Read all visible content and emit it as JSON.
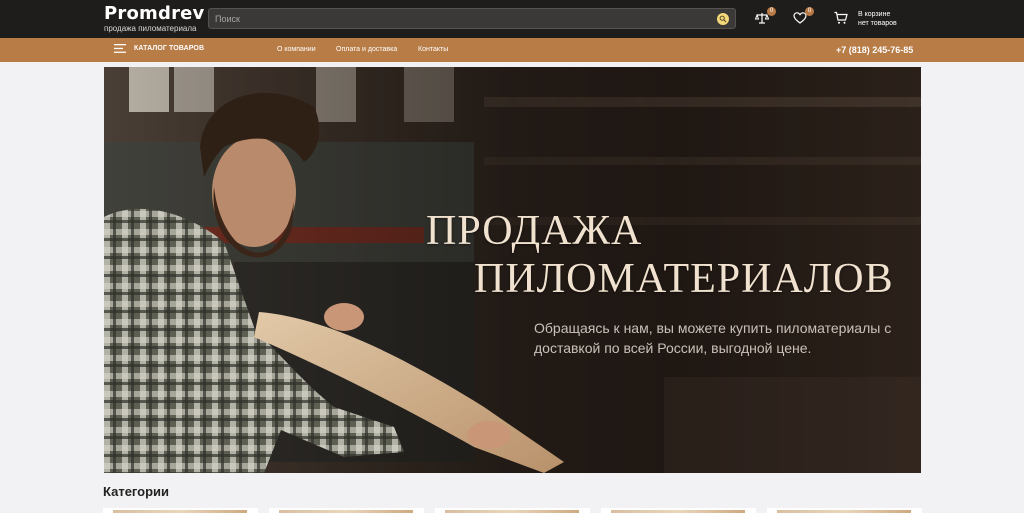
{
  "header": {
    "logo_name": "Promdrev",
    "logo_sub": "продажа пиломатериала",
    "search_placeholder": "Поиск",
    "compare_count": "0",
    "favorites_count": "0",
    "cart_line1": "В корзине",
    "cart_line2": "нет товаров"
  },
  "nav": {
    "catalog_label": "КАТАЛОГ ТОВАРОВ",
    "links": [
      "О компании",
      "Оплата и доставка",
      "Контакты"
    ],
    "phone": "+7 (818) 245-76-85"
  },
  "hero": {
    "title_line1": "ПРОДАЖА",
    "title_line2": "ПИЛОМАТЕРИАЛОВ",
    "subtitle": "Обращаясь к нам, вы можете купить пиломатериалы с доставкой по всей России, выгодной цене."
  },
  "categories": {
    "heading": "Категории"
  },
  "colors": {
    "topbar": "#1f1d1b",
    "accent": "#b87c47",
    "badge": "#b97a45"
  },
  "icons": [
    "menu-icon",
    "search-icon",
    "compare-icon",
    "heart-icon",
    "cart-icon"
  ]
}
